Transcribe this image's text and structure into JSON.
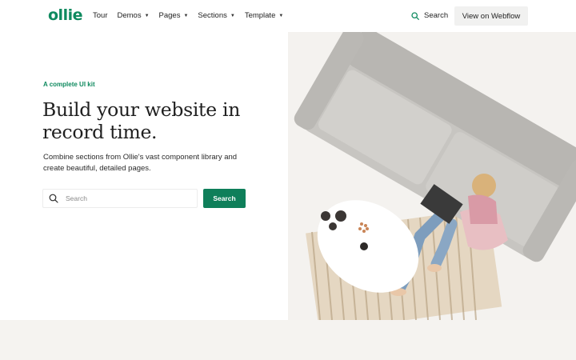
{
  "brand": {
    "logo": "ollie",
    "accent": "#0f8a5f"
  },
  "nav": {
    "items": [
      {
        "label": "Tour",
        "has_dropdown": false
      },
      {
        "label": "Demos",
        "has_dropdown": true
      },
      {
        "label": "Pages",
        "has_dropdown": true
      },
      {
        "label": "Sections",
        "has_dropdown": true
      },
      {
        "label": "Template",
        "has_dropdown": true
      }
    ],
    "search_label": "Search",
    "cta_label": "View on Webflow"
  },
  "hero": {
    "eyebrow": "A complete UI kit",
    "headline_line1": "Build your website in",
    "headline_line2": "record time.",
    "subtext_line1": "Combine sections from Ollie's vast component library and",
    "subtext_line2": "create beautiful, detailed pages.",
    "search_placeholder": "Search",
    "search_button": "Search"
  }
}
